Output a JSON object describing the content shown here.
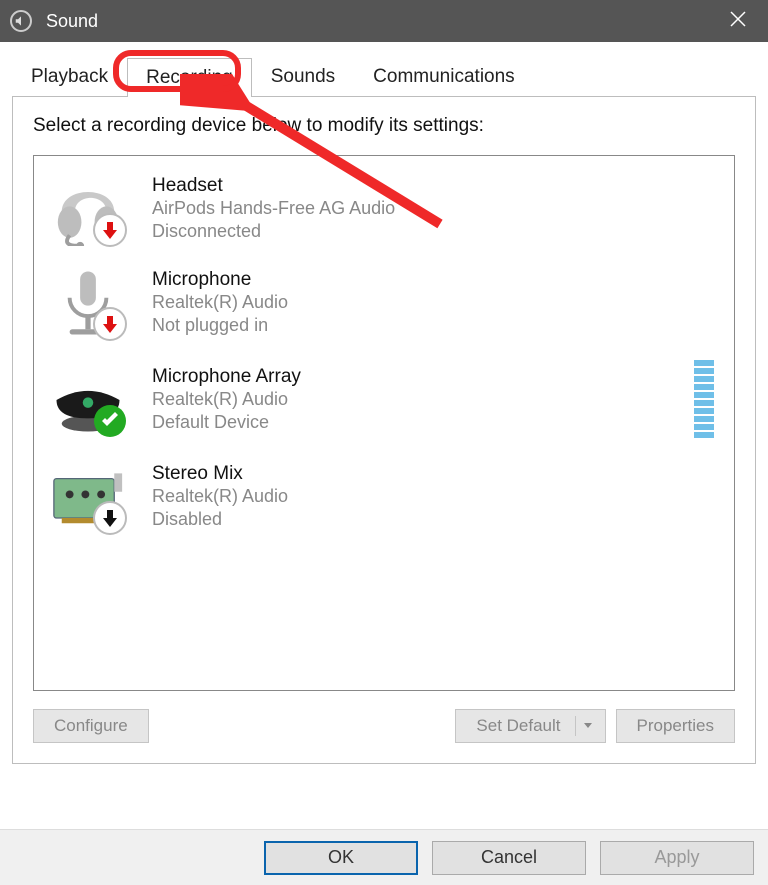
{
  "title": "Sound",
  "tabs": {
    "playback": "Playback",
    "recording": "Recording",
    "sounds": "Sounds",
    "communications": "Communications"
  },
  "active_tab": "recording",
  "instruction": "Select a recording device below to modify its settings:",
  "devices": [
    {
      "name": "Headset",
      "subtitle": "AirPods Hands-Free AG Audio",
      "status": "Disconnected",
      "icon": "headset",
      "badge": "red-down-arrow"
    },
    {
      "name": "Microphone",
      "subtitle": "Realtek(R) Audio",
      "status": "Not plugged in",
      "icon": "microphone",
      "badge": "red-down-arrow"
    },
    {
      "name": "Microphone Array",
      "subtitle": "Realtek(R) Audio",
      "status": "Default Device",
      "icon": "array",
      "badge": "green-check",
      "meter": true
    },
    {
      "name": "Stereo Mix",
      "subtitle": "Realtek(R) Audio",
      "status": "Disabled",
      "icon": "card",
      "badge": "black-down-arrow"
    }
  ],
  "buttons": {
    "configure": "Configure",
    "set_default": "Set Default",
    "properties": "Properties"
  },
  "footer": {
    "ok": "OK",
    "cancel": "Cancel",
    "apply": "Apply"
  }
}
